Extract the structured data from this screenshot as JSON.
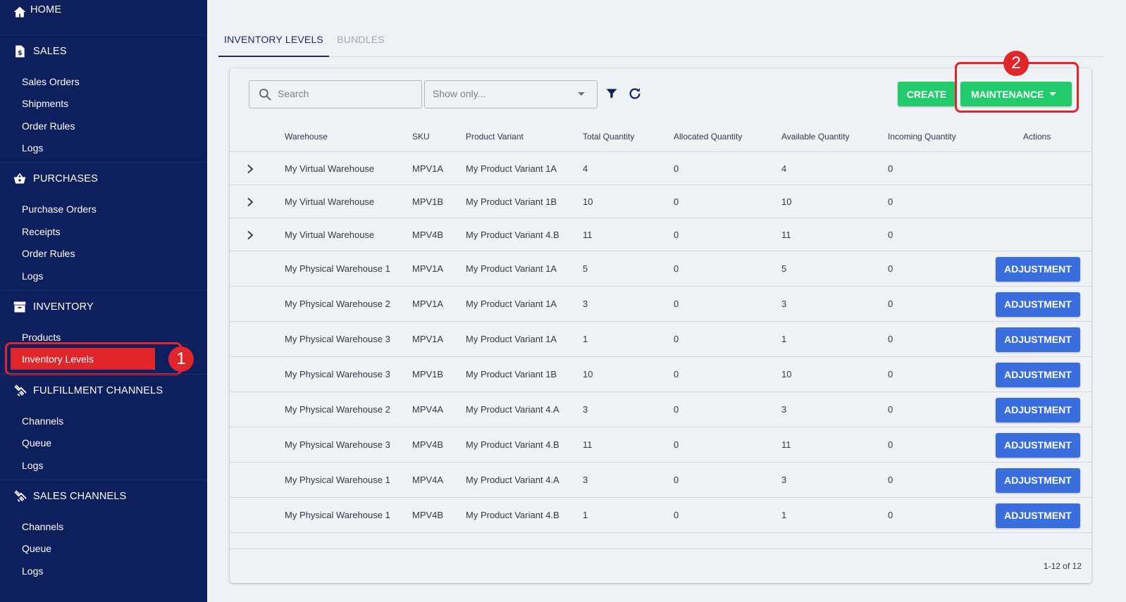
{
  "sidebar": {
    "home": "HOME",
    "sales": {
      "title": "SALES",
      "items": [
        "Sales Orders",
        "Shipments",
        "Order Rules",
        "Logs"
      ]
    },
    "purchases": {
      "title": "PURCHASES",
      "items": [
        "Purchase Orders",
        "Receipts",
        "Order Rules",
        "Logs"
      ]
    },
    "inventory": {
      "title": "INVENTORY",
      "items": [
        "Products",
        "Inventory Levels"
      ],
      "active": "Inventory Levels"
    },
    "fulfillment": {
      "title": "FULFILLMENT CHANNELS",
      "items": [
        "Channels",
        "Queue",
        "Logs"
      ]
    },
    "sales_channels": {
      "title": "SALES CHANNELS",
      "items": [
        "Channels",
        "Queue",
        "Logs"
      ]
    }
  },
  "annotations": {
    "badge1": "1",
    "badge2": "2",
    "color": "#e0262a"
  },
  "tabs": [
    "INVENTORY LEVELS",
    "BUNDLES"
  ],
  "toolbar": {
    "search_placeholder": "Search",
    "show_only_placeholder": "Show only...",
    "create_label": "CREATE",
    "maintenance_label": "MAINTENANCE"
  },
  "table": {
    "headers": [
      "Warehouse",
      "SKU",
      "Product Variant",
      "Total Quantity",
      "Allocated Quantity",
      "Available Quantity",
      "Incoming Quantity",
      "Actions"
    ],
    "rows": [
      {
        "warehouse": "My Virtual Warehouse",
        "sku": "MPV1A",
        "variant": "My Product Variant 1A",
        "total": "4",
        "allocated": "0",
        "available": "4",
        "incoming": "0",
        "expandable": true,
        "action": ""
      },
      {
        "warehouse": "My Virtual Warehouse",
        "sku": "MPV1B",
        "variant": "My Product Variant 1B",
        "total": "10",
        "allocated": "0",
        "available": "10",
        "incoming": "0",
        "expandable": true,
        "action": ""
      },
      {
        "warehouse": "My Virtual Warehouse",
        "sku": "MPV4B",
        "variant": "My Product Variant 4.B",
        "total": "11",
        "allocated": "0",
        "available": "11",
        "incoming": "0",
        "expandable": true,
        "action": ""
      },
      {
        "warehouse": "My Physical Warehouse 1",
        "sku": "MPV1A",
        "variant": "My Product Variant 1A",
        "total": "5",
        "allocated": "0",
        "available": "5",
        "incoming": "0",
        "expandable": false,
        "action": "ADJUSTMENT"
      },
      {
        "warehouse": "My Physical Warehouse 2",
        "sku": "MPV1A",
        "variant": "My Product Variant 1A",
        "total": "3",
        "allocated": "0",
        "available": "3",
        "incoming": "0",
        "expandable": false,
        "action": "ADJUSTMENT"
      },
      {
        "warehouse": "My Physical Warehouse 3",
        "sku": "MPV1A",
        "variant": "My Product Variant 1A",
        "total": "1",
        "allocated": "0",
        "available": "1",
        "incoming": "0",
        "expandable": false,
        "action": "ADJUSTMENT"
      },
      {
        "warehouse": "My Physical Warehouse 3",
        "sku": "MPV1B",
        "variant": "My Product Variant 1B",
        "total": "10",
        "allocated": "0",
        "available": "10",
        "incoming": "0",
        "expandable": false,
        "action": "ADJUSTMENT"
      },
      {
        "warehouse": "My Physical Warehouse 2",
        "sku": "MPV4A",
        "variant": "My Product Variant 4.A",
        "total": "3",
        "allocated": "0",
        "available": "3",
        "incoming": "0",
        "expandable": false,
        "action": "ADJUSTMENT"
      },
      {
        "warehouse": "My Physical Warehouse 3",
        "sku": "MPV4B",
        "variant": "My Product Variant 4.B",
        "total": "11",
        "allocated": "0",
        "available": "11",
        "incoming": "0",
        "expandable": false,
        "action": "ADJUSTMENT"
      },
      {
        "warehouse": "My Physical Warehouse 1",
        "sku": "MPV4A",
        "variant": "My Product Variant 4.A",
        "total": "3",
        "allocated": "0",
        "available": "3",
        "incoming": "0",
        "expandable": false,
        "action": "ADJUSTMENT"
      },
      {
        "warehouse": "My Physical Warehouse 1",
        "sku": "MPV4B",
        "variant": "My Product Variant 4.B",
        "total": "1",
        "allocated": "0",
        "available": "1",
        "incoming": "0",
        "expandable": false,
        "action": "ADJUSTMENT"
      }
    ]
  },
  "pagination": "1-12 of 12"
}
